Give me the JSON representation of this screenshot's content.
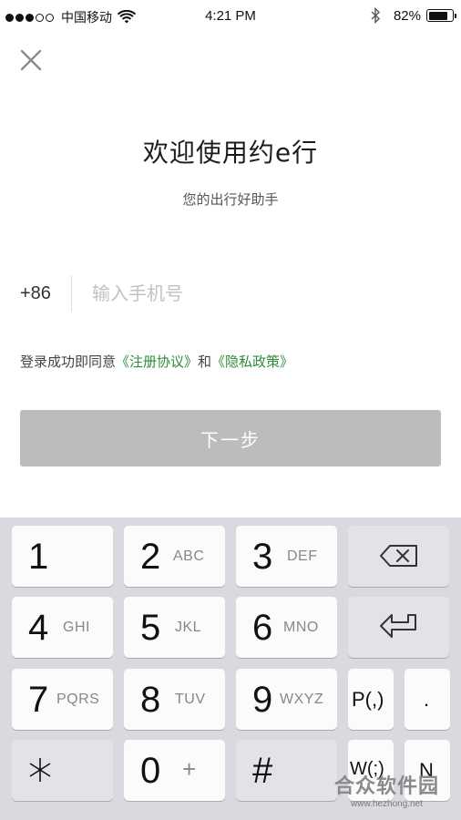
{
  "status_bar": {
    "carrier": "中国移动",
    "time": "4:21 PM",
    "battery_pct": "82%",
    "battery_level": 0.82,
    "signal_filled": 3,
    "signal_total": 5
  },
  "close_icon": "close-icon",
  "title": "欢迎使用约e行",
  "subtitle": "您的出行好助手",
  "phone": {
    "country_code": "+86",
    "placeholder": "输入手机号",
    "value": ""
  },
  "agreement": {
    "prefix": "登录成功即同意",
    "terms": "《注册协议》",
    "and": "和",
    "privacy": "《隐私政策》"
  },
  "next_button": "下一步",
  "colors": {
    "link": "#2e8b3a",
    "button_disabled": "#bcbcbc",
    "keyboard_bg": "#d8dadf"
  },
  "keyboard": {
    "k1": {
      "num": "1",
      "letters": ""
    },
    "k2": {
      "num": "2",
      "letters": "ABC"
    },
    "k3": {
      "num": "3",
      "letters": "DEF"
    },
    "k4": {
      "num": "4",
      "letters": "GHI"
    },
    "k5": {
      "num": "5",
      "letters": "JKL"
    },
    "k6": {
      "num": "6",
      "letters": "MNO"
    },
    "k7": {
      "num": "7",
      "letters": "PQRS"
    },
    "k8": {
      "num": "8",
      "letters": "TUV"
    },
    "k9": {
      "num": "9",
      "letters": "WXYZ"
    },
    "k0": {
      "num": "0",
      "letters": "+"
    },
    "star": "*",
    "hash": "#",
    "pause": "P(,)",
    "dot": ".",
    "wait": "W(;)",
    "n": "N",
    "backspace_icon": "backspace-icon",
    "enter_icon": "return-icon"
  },
  "watermark": {
    "text": "合众软件园",
    "url": "www.hezhong.net"
  }
}
